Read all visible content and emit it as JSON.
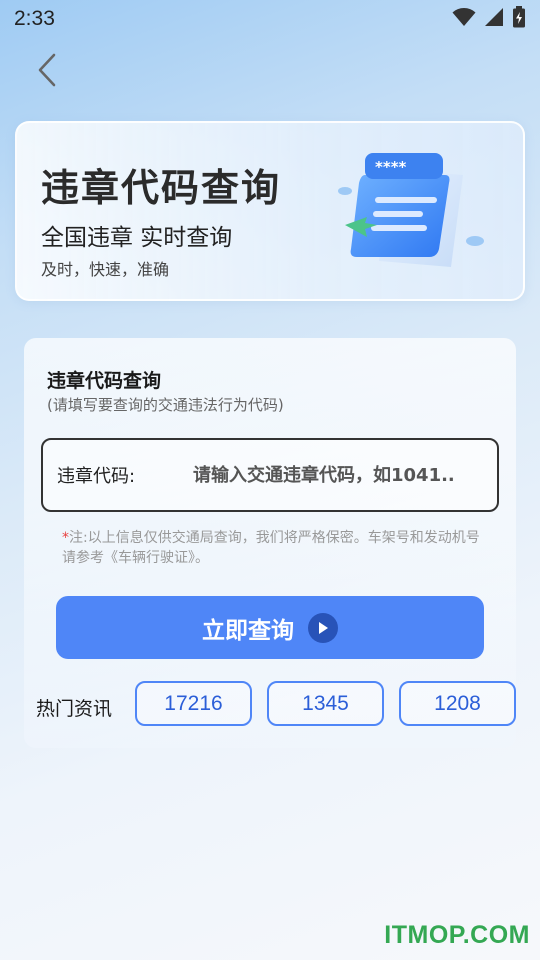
{
  "status_bar": {
    "time": "2:33",
    "icons": [
      "wifi-icon",
      "cellular-signal-icon",
      "battery-charging-icon"
    ]
  },
  "nav": {
    "back_icon": "chevron-left-icon"
  },
  "banner": {
    "title": "违章代码查询",
    "subtitle": "全国违章 实时查询",
    "tagline": "及时，快速，准确",
    "illustration_text": "****"
  },
  "form": {
    "title": "违章代码查询",
    "hint": "(请填写要查询的交通违法行为代码)",
    "code_label": "违章代码:",
    "code_placeholder": "请输入交通违章代码，如1041..",
    "code_value": "",
    "notice_star": "*",
    "notice": "注:以上信息仅供交通局查询，我们将严格保密。车架号和发动机号请参考《车辆行驶证》。",
    "submit_label": "立即查询",
    "submit_icon": "play-circle-icon"
  },
  "hot": {
    "label": "热门资讯",
    "items": [
      "17216",
      "1345",
      "1208"
    ]
  },
  "watermark": "ITMOP.COM",
  "colors": {
    "accent": "#4f86f7",
    "chip_text": "#2b5ed8",
    "notice_star": "#e8423f",
    "watermark": "#34a853"
  }
}
